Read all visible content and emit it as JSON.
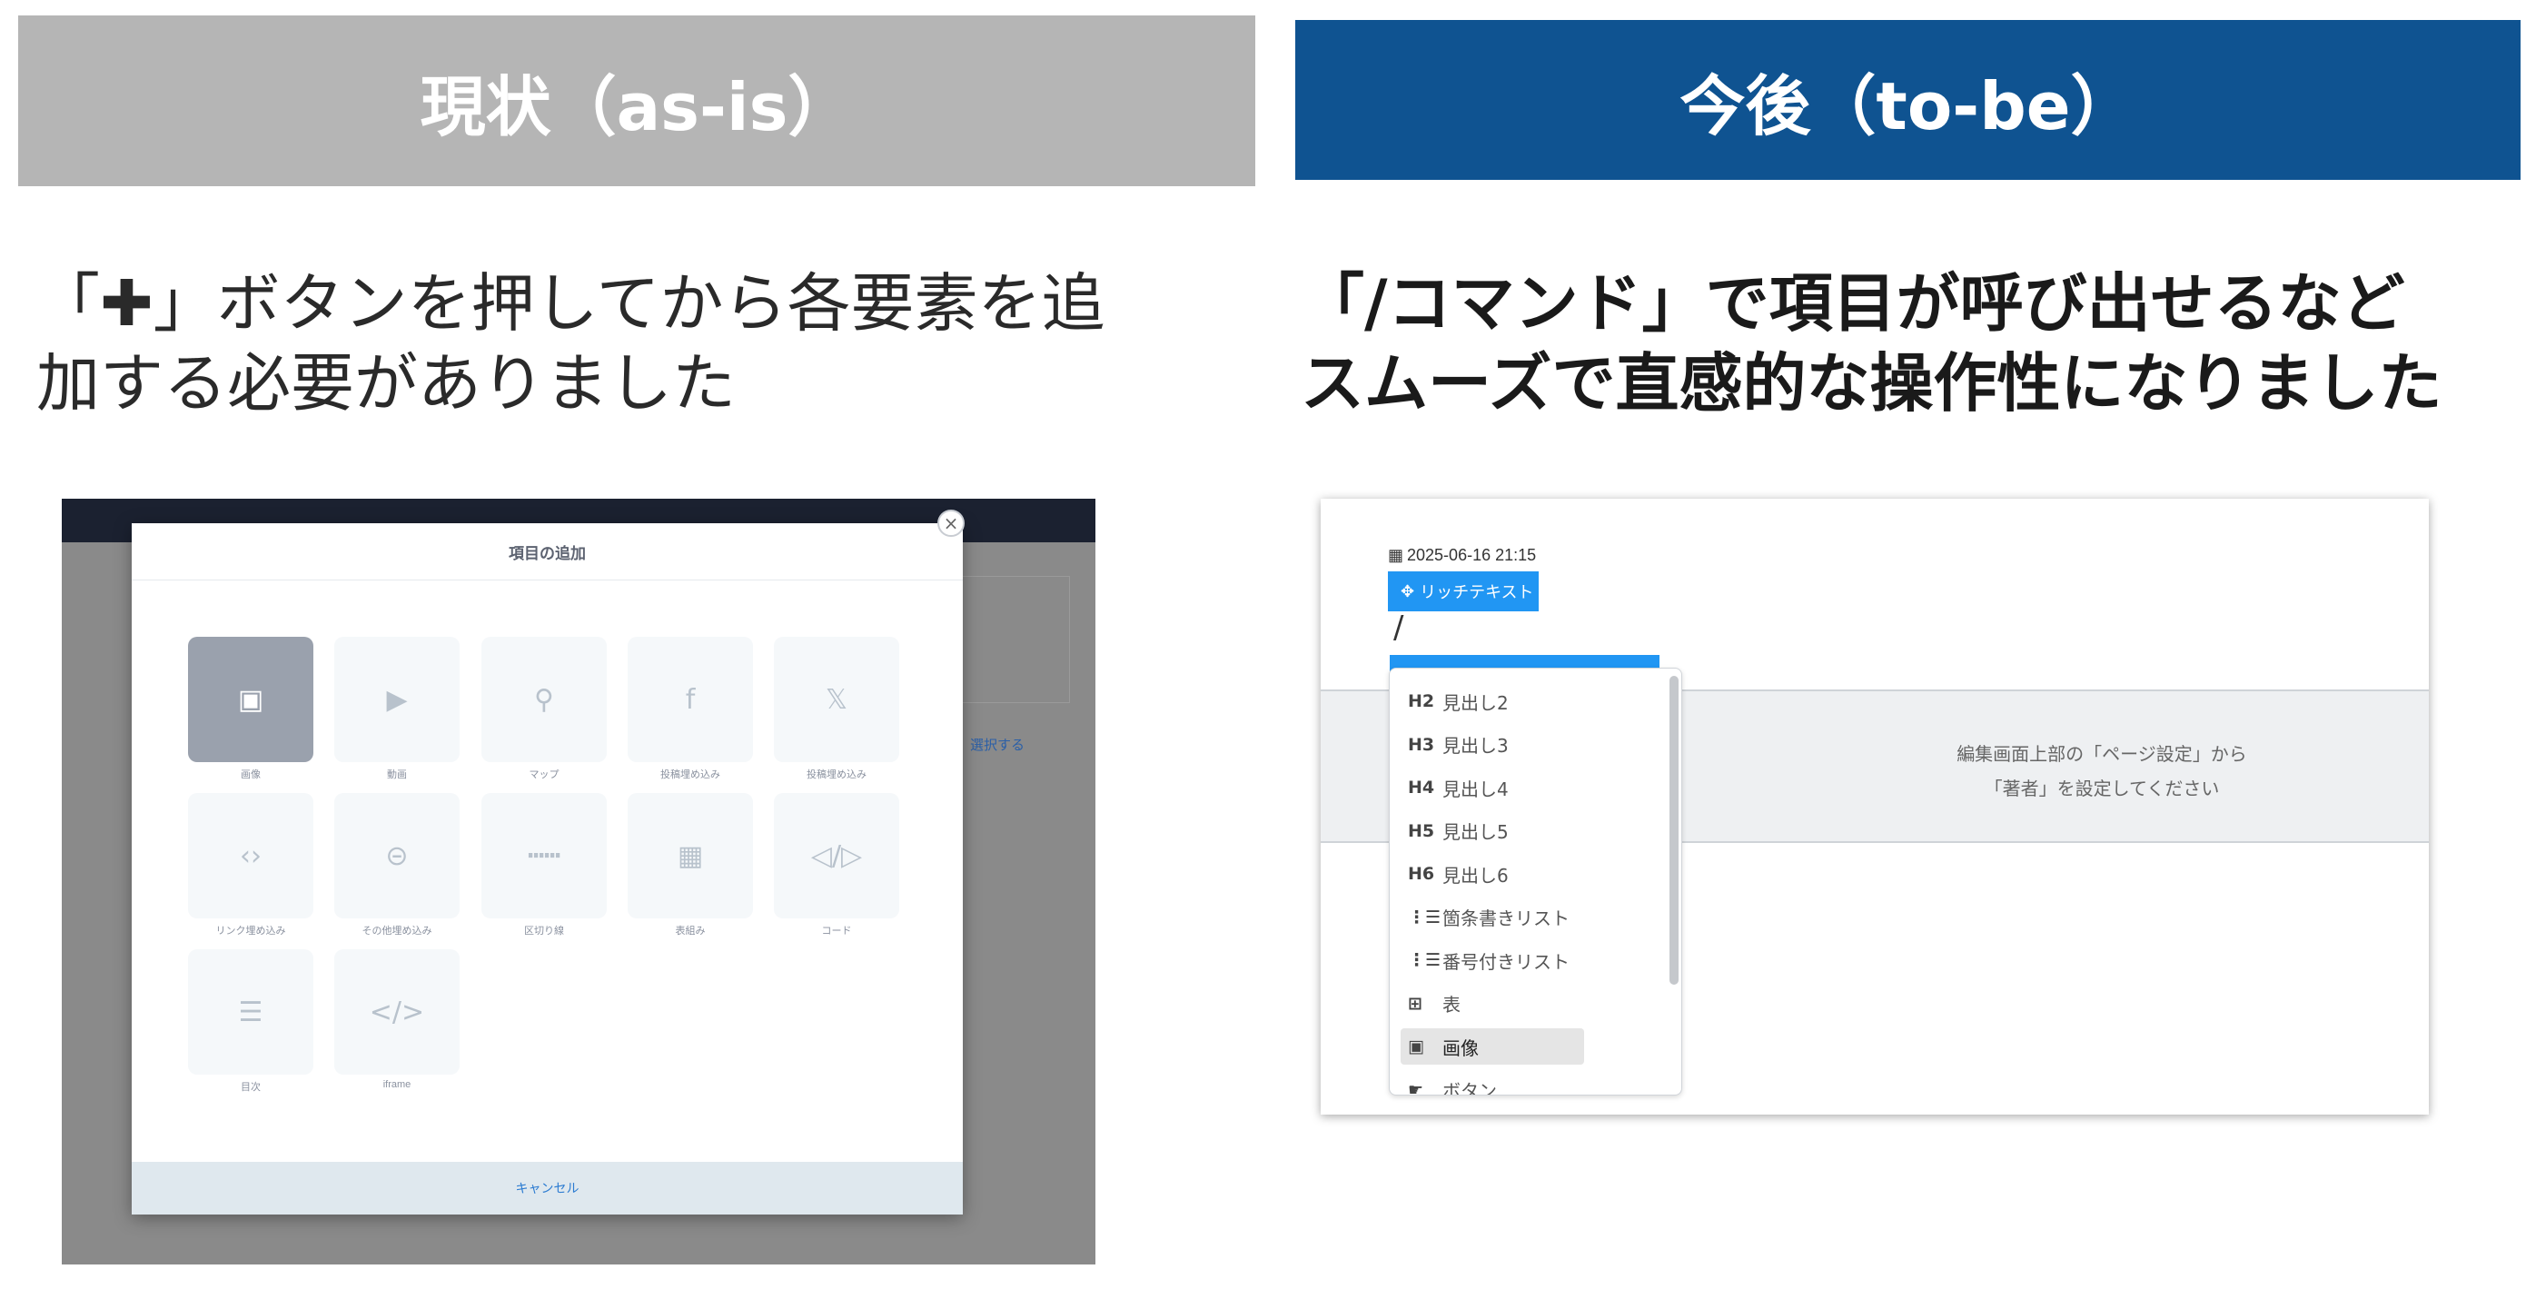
{
  "headers": {
    "left": "現状（as-is）",
    "right": "今後（to-be）"
  },
  "descriptions": {
    "left_lines": [
      "「✚」ボタンを押してから各要素を追",
      "加する必要がありました"
    ],
    "right_lines": [
      "「/コマンド」で項目が呼び出せるなど",
      "スムーズで直感的な操作性になりました"
    ]
  },
  "as_is": {
    "background_link": "選択する",
    "modal_title": "項目の追加",
    "close_symbol": "×",
    "tiles": [
      {
        "label": "画像",
        "icon": "image-icon",
        "glyph": "▣",
        "active": true
      },
      {
        "label": "動画",
        "icon": "video-icon",
        "glyph": "▶",
        "active": false
      },
      {
        "label": "マップ",
        "icon": "map-pin-icon",
        "glyph": "⚲",
        "active": false
      },
      {
        "label": "投稿埋め込み",
        "icon": "facebook-icon",
        "glyph": "f",
        "active": false
      },
      {
        "label": "投稿埋め込み",
        "icon": "x-logo-icon",
        "glyph": "𝕏",
        "active": false
      },
      {
        "label": "リンク埋め込み",
        "icon": "code-brackets-icon",
        "glyph": "‹›",
        "active": false
      },
      {
        "label": "その他埋め込み",
        "icon": "link-icon",
        "glyph": "⊝",
        "active": false
      },
      {
        "label": "区切り線",
        "icon": "divider-icon",
        "glyph": "┅┅",
        "active": false
      },
      {
        "label": "表組み",
        "icon": "table-icon",
        "glyph": "▦",
        "active": false
      },
      {
        "label": "コード",
        "icon": "code-icon",
        "glyph": "◁/▷",
        "active": false
      },
      {
        "label": "目次",
        "icon": "toc-icon",
        "glyph": "☰",
        "active": false
      },
      {
        "label": "iframe",
        "icon": "iframe-icon",
        "glyph": "</>",
        "active": false
      }
    ],
    "cancel_label": "キャンセル"
  },
  "to_be": {
    "timestamp": "2025-06-16 21:15",
    "rich_text_label": "リッチテキスト",
    "typed_text": "/",
    "author_msg_lines": [
      "編集画面上部の「ページ設定」から",
      "「著者」を設定してください"
    ],
    "menu_items": [
      {
        "icon_text": "H2",
        "label": "見出し2",
        "icon": "heading-2-icon",
        "active": false
      },
      {
        "icon_text": "H3",
        "label": "見出し3",
        "icon": "heading-3-icon",
        "active": false
      },
      {
        "icon_text": "H4",
        "label": "見出し4",
        "icon": "heading-4-icon",
        "active": false
      },
      {
        "icon_text": "H5",
        "label": "見出し5",
        "icon": "heading-5-icon",
        "active": false
      },
      {
        "icon_text": "H6",
        "label": "見出し6",
        "icon": "heading-6-icon",
        "active": false
      },
      {
        "icon_text": "⋮☰",
        "label": "箇条書きリスト",
        "icon": "bullet-list-icon",
        "active": false
      },
      {
        "icon_text": "⋮☰",
        "label": "番号付きリスト",
        "icon": "numbered-list-icon",
        "active": false
      },
      {
        "icon_text": "⊞",
        "label": "表",
        "icon": "table-icon",
        "active": false
      },
      {
        "icon_text": "▣",
        "label": "画像",
        "icon": "image-icon",
        "active": true
      },
      {
        "icon_text": "☛",
        "label": "ボタン",
        "icon": "button-icon",
        "active": false
      }
    ]
  }
}
